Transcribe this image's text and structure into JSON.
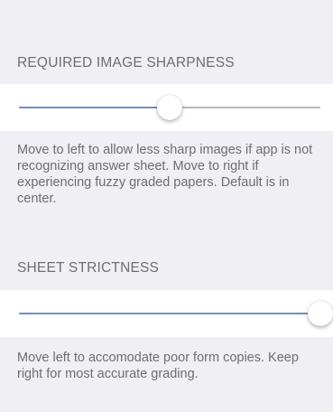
{
  "sections": [
    {
      "header": "REQUIRED IMAGE SHARPNESS",
      "slider_value": 0.5,
      "footer": "Move to left to allow less sharp images if app is not recognizing answer sheet. Move to right if experiencing fuzzy graded papers.  Default is in center."
    },
    {
      "header": "SHEET STRICTNESS",
      "slider_value": 1.0,
      "footer": "Move left to accomodate poor form copies.  Keep right for most accurate grading."
    }
  ],
  "colors": {
    "background": "#efeff4",
    "cell": "#ffffff",
    "track_min": "#6f8ec9",
    "track_max": "#b7b7b7",
    "header_text": "#6d6d72"
  }
}
